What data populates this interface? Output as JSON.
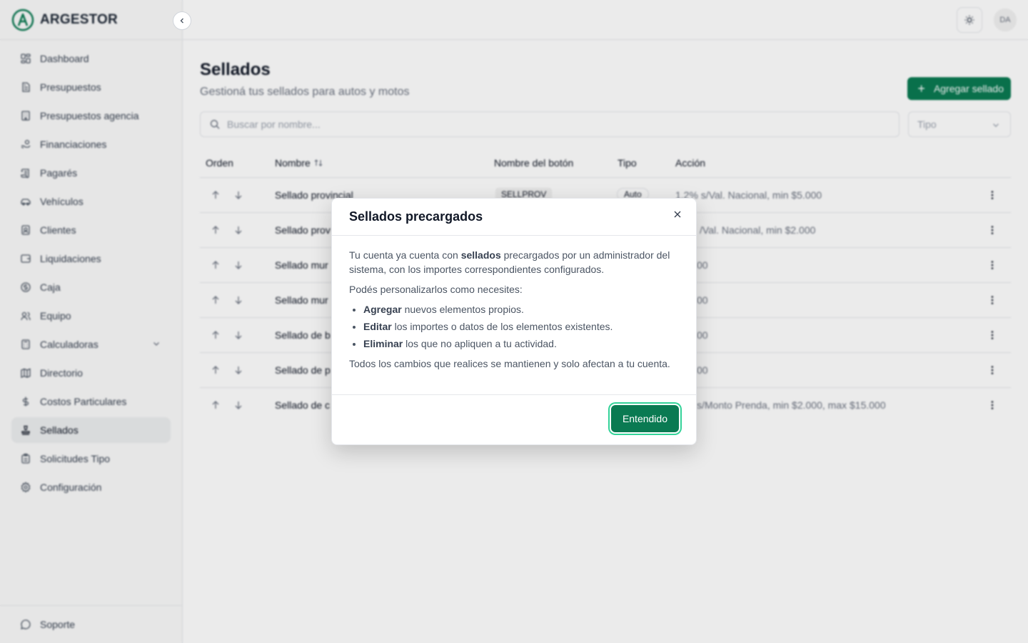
{
  "brand": {
    "name": "ARGESTOR"
  },
  "sidebar": {
    "items": [
      {
        "label": "Dashboard",
        "icon": "dashboard-icon"
      },
      {
        "label": "Presupuestos",
        "icon": "document-icon"
      },
      {
        "label": "Presupuestos agencia",
        "icon": "building-icon"
      },
      {
        "label": "Financiaciones",
        "icon": "handcoins-icon"
      },
      {
        "label": "Pagarés",
        "icon": "scroll-icon"
      },
      {
        "label": "Vehículos",
        "icon": "car-icon"
      },
      {
        "label": "Clientes",
        "icon": "contact-icon"
      },
      {
        "label": "Liquidaciones",
        "icon": "wallet-icon"
      },
      {
        "label": "Caja",
        "icon": "coin-icon"
      },
      {
        "label": "Equipo",
        "icon": "users-icon"
      },
      {
        "label": "Calculadoras",
        "icon": "calculator-icon"
      },
      {
        "label": "Directorio",
        "icon": "map-icon"
      },
      {
        "label": "Costos Particulares",
        "icon": "dollar-icon"
      },
      {
        "label": "Sellados",
        "icon": "stamp-icon",
        "active": true
      },
      {
        "label": "Solicitudes Tipo",
        "icon": "clipboard-icon"
      },
      {
        "label": "Configuración",
        "icon": "gear-icon"
      }
    ],
    "support_label": "Soporte"
  },
  "topbar": {
    "avatar_initials": "DA"
  },
  "page": {
    "title": "Sellados",
    "subtitle": "Gestioná tus sellados para autos y motos",
    "add_button": "Agregar sellado",
    "search_placeholder": "Buscar por nombre...",
    "type_placeholder": "Tipo"
  },
  "table": {
    "headers": {
      "orden": "Orden",
      "nombre": "Nombre",
      "boton": "Nombre del botón",
      "tipo": "Tipo",
      "accion": "Acción"
    },
    "rows": [
      {
        "name": "Sellado provincial",
        "button": "SELLPROV",
        "tipo": "Auto",
        "accion": "1.2% s/Val. Nacional, min $5.000"
      },
      {
        "name": "Sellado prov",
        "button": "",
        "tipo": "",
        "accion": "/Val. Nacional, min $2.000"
      },
      {
        "name": "Sellado mur",
        "button": "",
        "tipo": "",
        "accion": "00"
      },
      {
        "name": "Sellado mur",
        "button": "",
        "tipo": "",
        "accion": "00"
      },
      {
        "name": "Sellado de b",
        "button": "",
        "tipo": "",
        "accion": "00"
      },
      {
        "name": "Sellado de p",
        "button": "",
        "tipo": "",
        "accion": "00"
      },
      {
        "name": "Sellado de c",
        "button": "",
        "tipo": "",
        "accion": "s/Monto Prenda, min $2.000, max $15.000"
      }
    ]
  },
  "modal": {
    "title": "Sellados precargados",
    "p1_before": "Tu cuenta ya cuenta con ",
    "p1_bold": "sellados",
    "p1_after": " precargados por un administrador del sistema, con los importes correspondientes configurados.",
    "p2": "Podés personalizarlos como necesites:",
    "bullets": [
      {
        "bold": "Agregar",
        "text": " nuevos elementos propios."
      },
      {
        "bold": "Editar",
        "text": " los importes o datos de los elementos existentes."
      },
      {
        "bold": "Eliminar",
        "text": " los que no apliquen a tu actividad."
      }
    ],
    "p3": "Todos los cambios que realices se mantienen y solo afectan a tu cuenta.",
    "ok_button": "Entendido"
  },
  "colors": {
    "accent": "#0a7a52",
    "focus_ring": "#34d399"
  }
}
